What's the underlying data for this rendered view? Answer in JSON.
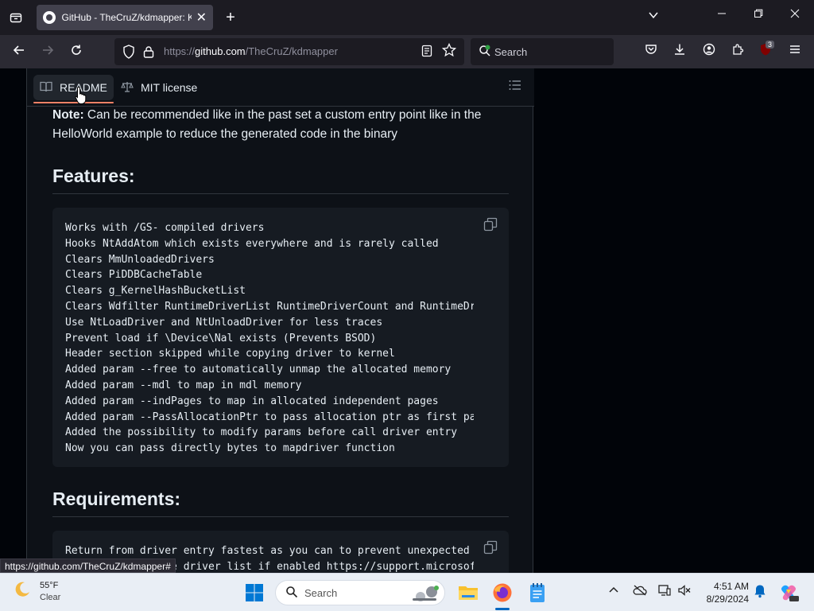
{
  "browser": {
    "tab": {
      "title": "GitHub - TheCruZ/kdmapper: K",
      "close": "✕"
    },
    "new_tab": "+",
    "url": {
      "scheme": "https://",
      "host": "github.com",
      "path": "/TheCruZ/kdmapper"
    },
    "search_placeholder": "Search",
    "extension_badge": "3",
    "status_link": "https://github.com/TheCruZ/kdmapper#"
  },
  "readme": {
    "tabs": [
      {
        "label": "README",
        "icon": "book-icon",
        "active": true
      },
      {
        "label": "MIT license",
        "icon": "scale-icon",
        "active": false
      }
    ],
    "note_label": "Note:",
    "note_text": " Can be recommended like in the past set a custom entry point like in the HelloWorld example to reduce the generated code in the binary",
    "features_heading": "Features:",
    "features_code": "Works with /GS- compiled drivers\nHooks NtAddAtom which exists everywhere and is rarely called\nClears MmUnloadedDrivers\nClears PiDDBCacheTable\nClears g_KernelHashBucketList\nClears Wdfilter RuntimeDriverList RuntimeDriverCount and RuntimeDriverArr\nUse NtLoadDriver and NtUnloadDriver for less traces\nPrevent load if \\Device\\Nal exists (Prevents BSOD)\nHeader section skipped while copying driver to kernel\nAdded param --free to automatically unmap the allocated memory\nAdded param --mdl to map in mdl memory\nAdded param --indPages to map in allocated independent pages\nAdded param --PassAllocationPtr to pass allocation ptr as first param\nAdded the possibility to modify params before call driver entry\nNow you can pass directly bytes to mapdriver function",
    "requirements_heading": "Requirements:",
    "requirements_code": "Return from driver entry fastest as you can to prevent unexpected results\nDisable vulnerable driver list if enabled https://support.microsoft.com"
  },
  "taskbar": {
    "weather_temp": "55°F",
    "weather_desc": "Clear",
    "search_placeholder": "Search",
    "time": "4:51 AM",
    "date": "8/29/2024"
  },
  "colors": {
    "accent_tab_underline": "#f78166",
    "page_bg": "#0d1117",
    "code_bg": "#161b22",
    "taskbar_active": "#0067c0"
  }
}
